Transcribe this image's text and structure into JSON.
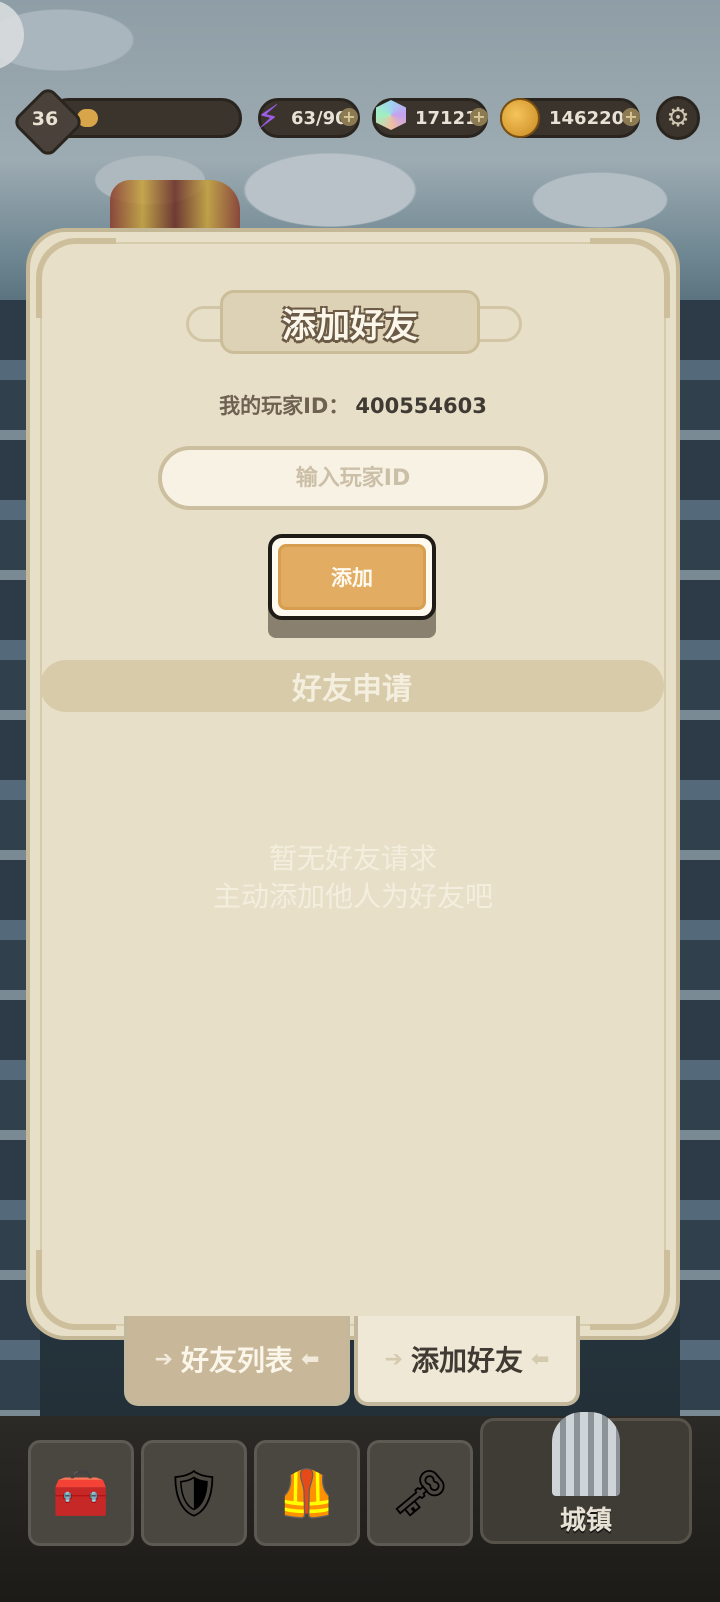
{
  "hud": {
    "level": "36",
    "xp_progress": 0.07,
    "energy": "63/90",
    "gems": "17121",
    "coins": "146220",
    "plus_glyph": "+",
    "icons": {
      "energy": "lightning-icon",
      "gem": "gem-icon",
      "coin": "coin-icon",
      "settings": "gear-icon"
    }
  },
  "panel": {
    "title": "添加好友",
    "my_id_label": "我的玩家ID：",
    "my_id_value": "400554603",
    "input_placeholder": "输入玩家ID",
    "add_button": "添加",
    "requests_header": "好友申请",
    "empty_line1": "暂无好友请求",
    "empty_line2": "主动添加他人为好友吧"
  },
  "tabs": {
    "friends_list": "好友列表",
    "add_friend": "添加好友",
    "active": "add_friend"
  },
  "bottom_nav": {
    "town_label": "城镇",
    "icons": [
      "chest-icon",
      "sword-shield-icon",
      "armor-icon",
      "map-key-icon",
      "town-hall-icon"
    ]
  },
  "colors": {
    "panel_bg": "#e7dfc7",
    "button_orange": "#e2ac62",
    "hud_dark": "#3b342d"
  }
}
